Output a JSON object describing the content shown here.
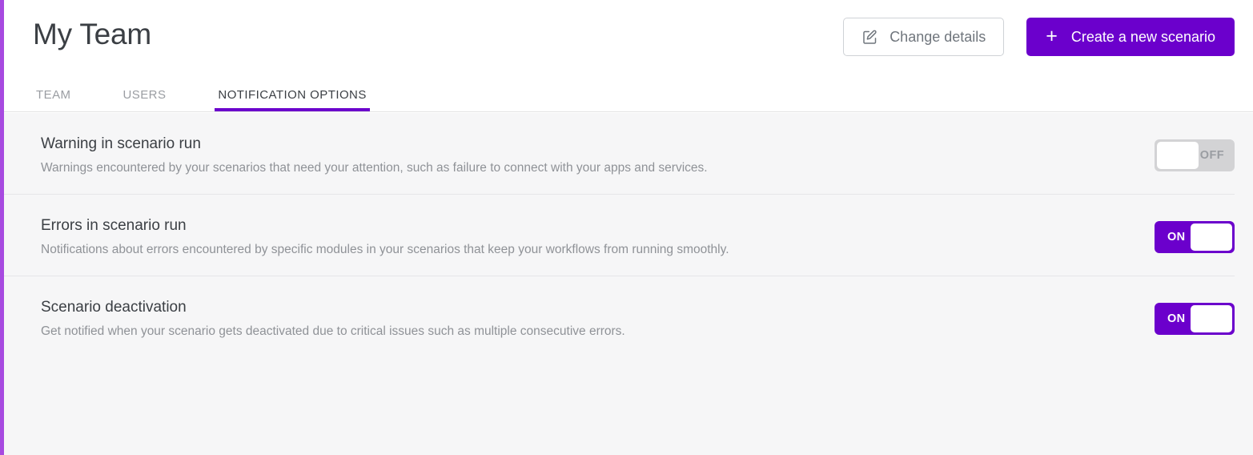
{
  "header": {
    "title": "My Team",
    "change_details_label": "Change details",
    "change_details_icon": "edit-pencil-square-icon",
    "create_scenario_label": "Create a new scenario",
    "create_scenario_icon": "plus-icon"
  },
  "tabs": [
    {
      "label": "TEAM",
      "active": false
    },
    {
      "label": "USERS",
      "active": false
    },
    {
      "label": "NOTIFICATION OPTIONS",
      "active": true
    }
  ],
  "notifications": [
    {
      "title": "Warning in scenario run",
      "description": "Warnings encountered by your scenarios that need your attention, such as failure to connect with your apps and services.",
      "toggle_state": "OFF",
      "toggle_on": false
    },
    {
      "title": "Errors in scenario run",
      "description": "Notifications about errors encountered by specific modules in your scenarios that keep your workflows from running smoothly.",
      "toggle_state": "ON",
      "toggle_on": true
    },
    {
      "title": "Scenario deactivation",
      "description": "Get notified when your scenario gets deactivated due to critical issues such as multiple consecutive errors.",
      "toggle_state": "ON",
      "toggle_on": true
    }
  ],
  "colors": {
    "accent_purple": "#6b00cc",
    "rail_purple": "#a74ae0",
    "toggle_off_bg": "#d3d3d5",
    "content_bg": "#f6f6f7",
    "text_primary": "#3b3f44",
    "text_muted": "#8f9297"
  }
}
